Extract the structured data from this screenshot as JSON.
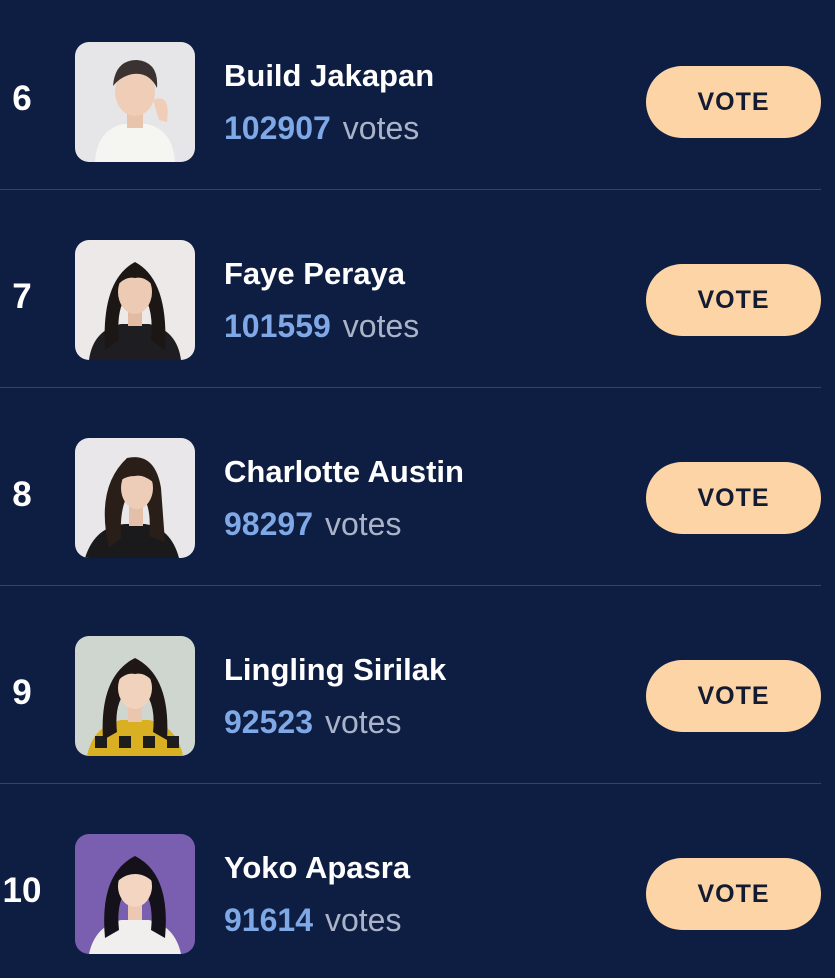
{
  "entries": [
    {
      "rank": "6",
      "name": "Build Jakapan",
      "votes": "102907",
      "unit": "votes",
      "button": "VOTE"
    },
    {
      "rank": "7",
      "name": "Faye Peraya",
      "votes": "101559",
      "unit": "votes",
      "button": "VOTE"
    },
    {
      "rank": "8",
      "name": "Charlotte Austin",
      "votes": "98297",
      "unit": "votes",
      "button": "VOTE"
    },
    {
      "rank": "9",
      "name": "Lingling Sirilak",
      "votes": "92523",
      "unit": "votes",
      "button": "VOTE"
    },
    {
      "rank": "10",
      "name": "Yoko Apasra",
      "votes": "91614",
      "unit": "votes",
      "button": "VOTE"
    }
  ],
  "colors": {
    "background": "#0e1d42",
    "accent_votes": "#7fa8e6",
    "button": "#fdd4a6"
  }
}
